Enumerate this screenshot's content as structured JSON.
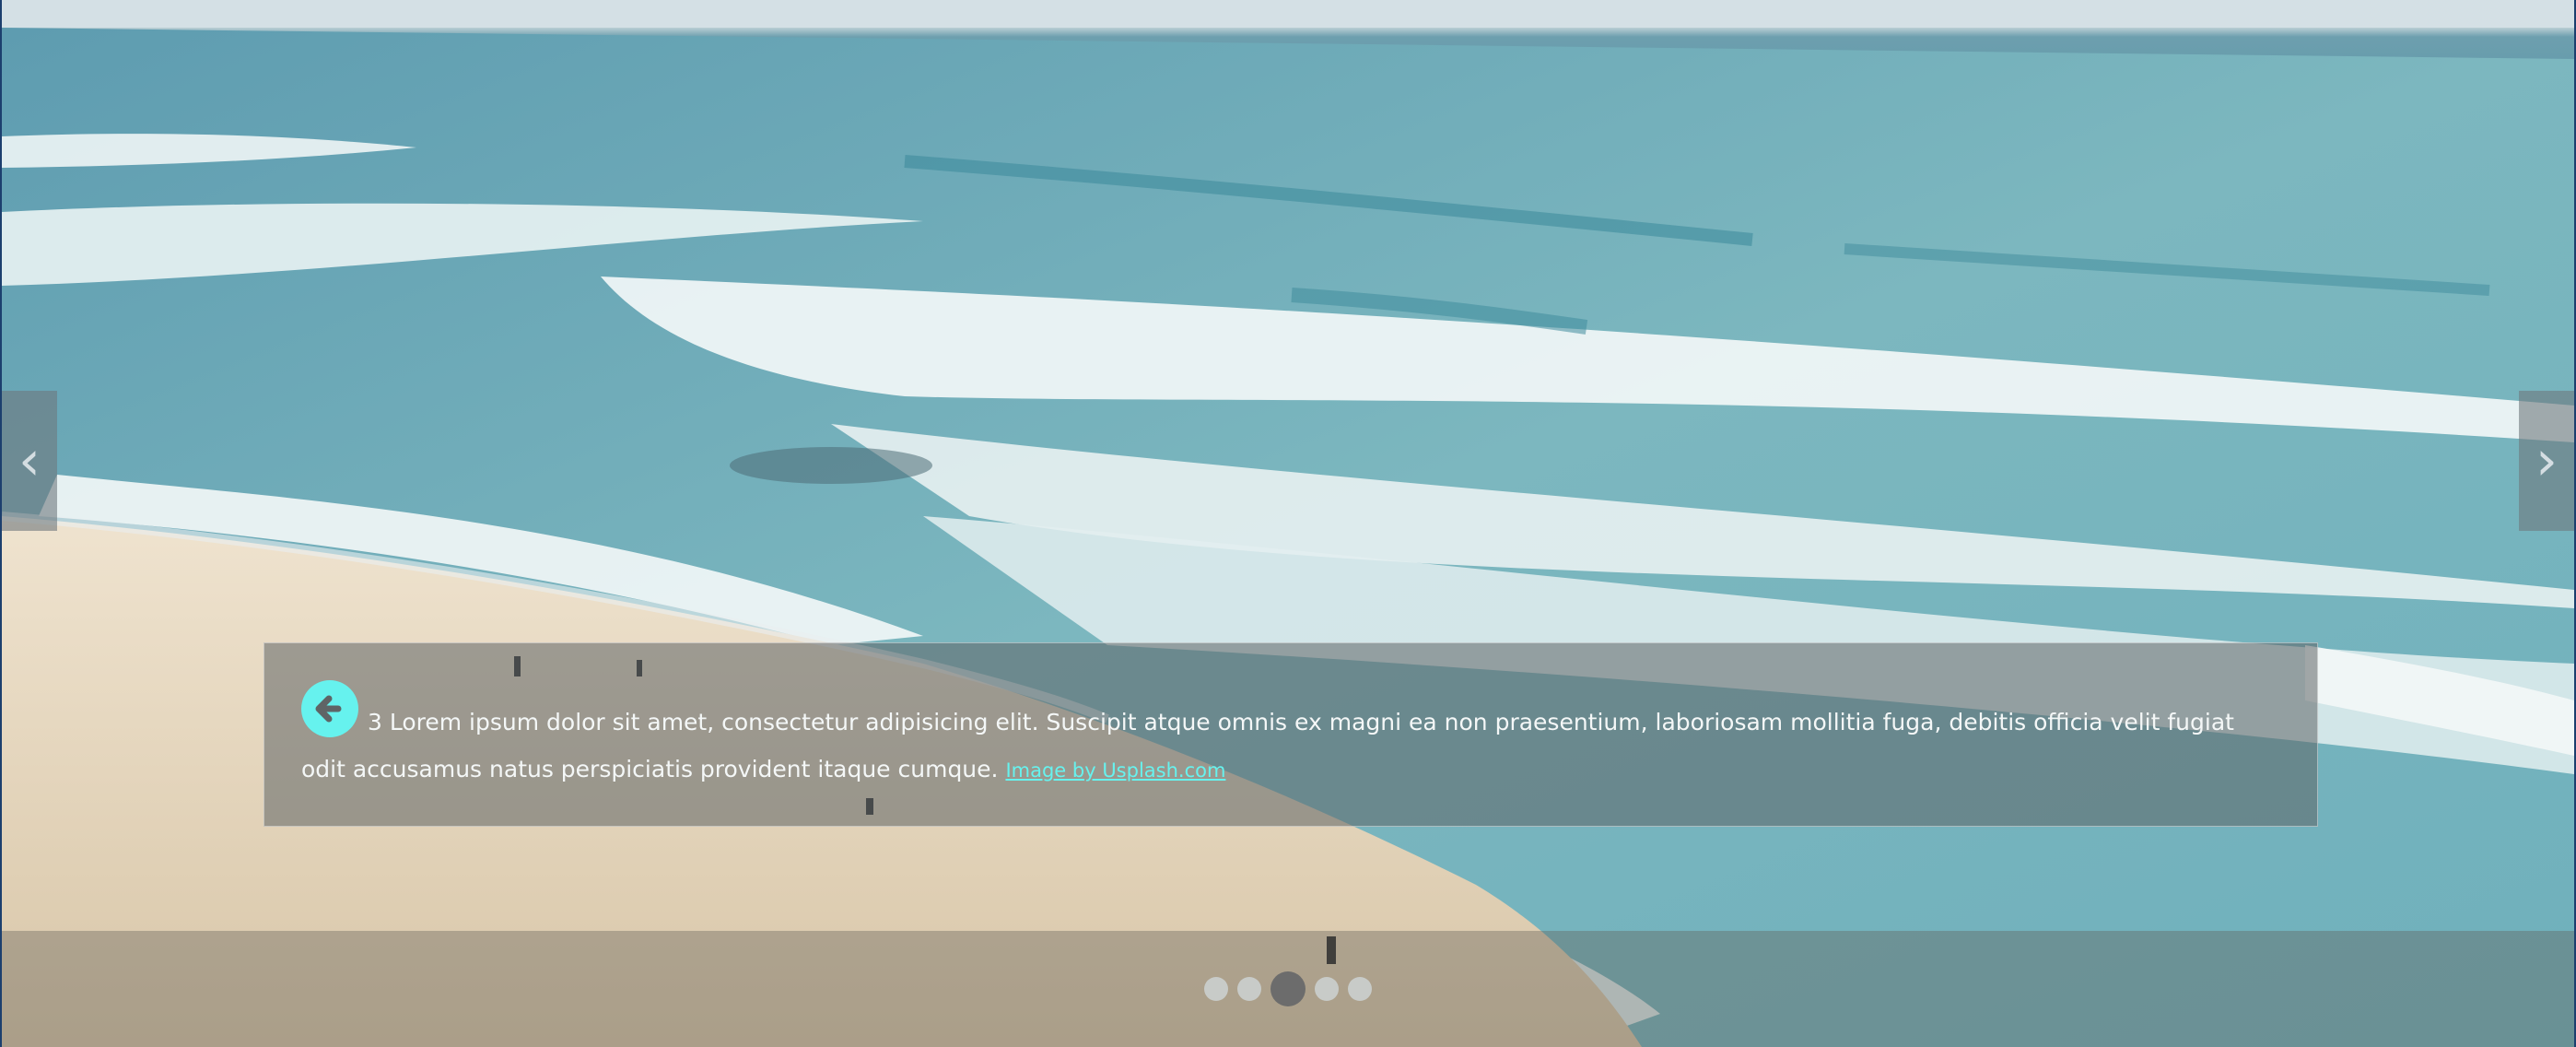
{
  "carousel": {
    "background_image": "beach-ocean-photo",
    "prev_arrow": "‹",
    "next_arrow": "›",
    "prev_icon": "chevron-left-icon",
    "next_icon": "chevron-right-icon"
  },
  "caption": {
    "icon": "arrow-left-circle-icon",
    "icon_color": "#66f2ee",
    "text": "3 Lorem ipsum dolor sit amet, consectetur adipisicing elit. Suscipit atque omnis ex magni ea non praesentium, laboriosam mollitia fuga, debitis officia velit fugiat odit accusamus natus perspiciatis provident itaque cumque.",
    "link_text": "Image by Usplash.com"
  },
  "indicators": {
    "count": 5,
    "active_index": 2,
    "labels": [
      "",
      "",
      "",
      "",
      ""
    ]
  },
  "colors": {
    "link": "#66f2ee",
    "active_dot": "#6c6c6c"
  }
}
